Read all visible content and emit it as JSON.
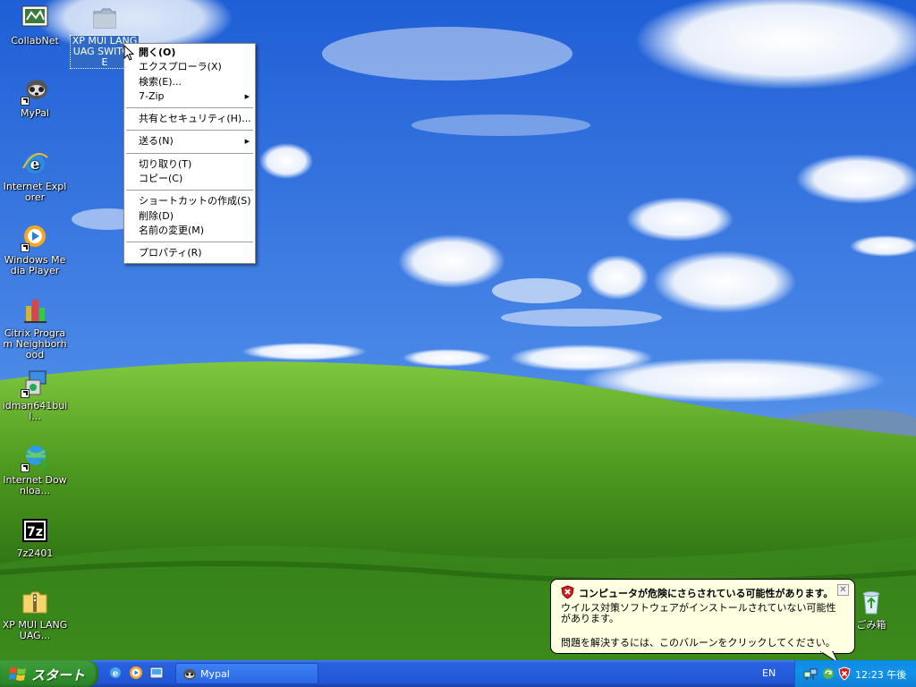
{
  "desktop": {
    "icons": [
      {
        "label": "CollabNet"
      },
      {
        "label": "XP MUI LANGUAG SWITCHE"
      },
      {
        "label": "MyPal"
      },
      {
        "label": "Internet Explorer"
      },
      {
        "label": "Windows Media Player"
      },
      {
        "label": "Citrix Program Neighborhood"
      },
      {
        "label": "idman641buil..."
      },
      {
        "label": "Internet Downloa..."
      },
      {
        "label": "7z2401"
      },
      {
        "label": "XP MUI LANGUAG..."
      },
      {
        "label": "ごみ箱"
      }
    ]
  },
  "context_menu": {
    "items": [
      {
        "label": "開く(O)"
      },
      {
        "label": "エクスプローラ(X)"
      },
      {
        "label": "検索(E)..."
      },
      {
        "label": "7-Zip"
      },
      {
        "label": "共有とセキュリティ(H)..."
      },
      {
        "label": "送る(N)"
      },
      {
        "label": "切り取り(T)"
      },
      {
        "label": "コピー(C)"
      },
      {
        "label": "ショートカットの作成(S)"
      },
      {
        "label": "削除(D)"
      },
      {
        "label": "名前の変更(M)"
      },
      {
        "label": "プロパティ(R)"
      }
    ]
  },
  "balloon": {
    "title": "コンピュータが危険にさらされている可能性があります。",
    "body": "ウイルス対策ソフトウェアがインストールされていない可能性があります。",
    "action": "問題を解決するには、このバルーンをクリックしてください。",
    "close": "✕"
  },
  "taskbar": {
    "start_label": "スタート",
    "task_label": "Mypal",
    "language": "EN",
    "clock": "12:23 午後"
  },
  "colors": {
    "taskbar_blue": "#245ddb",
    "start_green": "#3b9b39",
    "tray_blue": "#1192e9",
    "balloon_bg": "#ffffe1",
    "selection_blue": "#316ac5"
  }
}
